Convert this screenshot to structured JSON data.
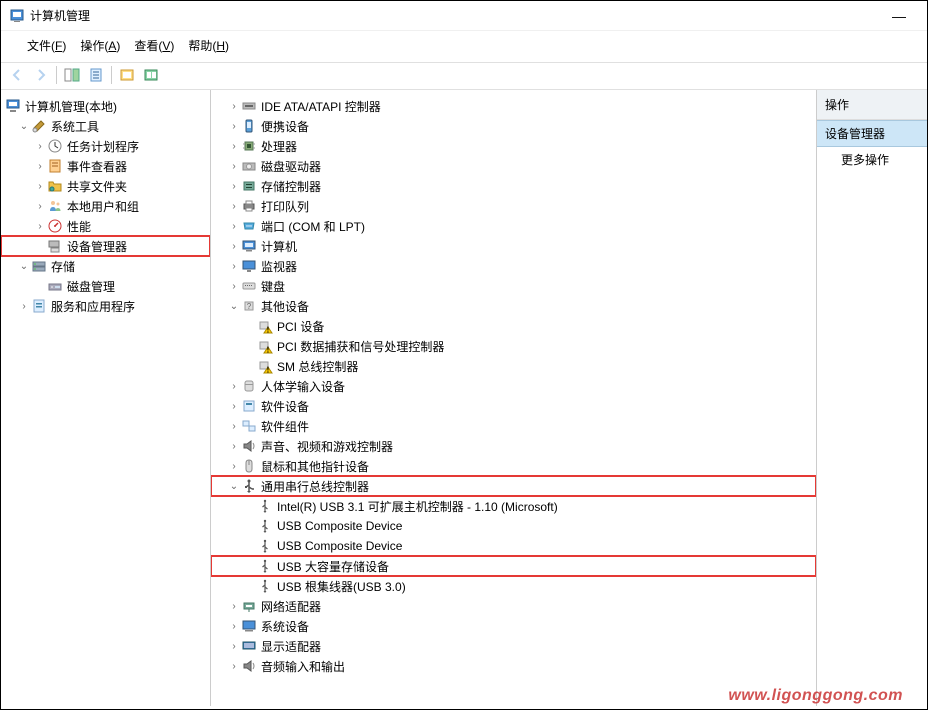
{
  "window": {
    "title": "计算机管理",
    "minimize": "—"
  },
  "menubar": {
    "file": "文件(F)",
    "action": "操作(A)",
    "view": "查看(V)",
    "help": "帮助(H)"
  },
  "left_tree": {
    "root": "计算机管理(本地)",
    "system_tools": "系统工具",
    "task_scheduler": "任务计划程序",
    "event_viewer": "事件查看器",
    "shared_folders": "共享文件夹",
    "local_users": "本地用户和组",
    "performance": "性能",
    "device_manager": "设备管理器",
    "storage": "存储",
    "disk_management": "磁盘管理",
    "services_apps": "服务和应用程序"
  },
  "dev_tree": {
    "ide": "IDE ATA/ATAPI 控制器",
    "portable": "便携设备",
    "cpu": "处理器",
    "dvd": "磁盘驱动器",
    "storage_ctrl": "存储控制器",
    "print_queue": "打印队列",
    "ports": "端口 (COM 和 LPT)",
    "computer": "计算机",
    "monitor": "监视器",
    "keyboard": "键盘",
    "other": "其他设备",
    "pci_device": "PCI 设备",
    "pci_data": "PCI 数据捕获和信号处理控制器",
    "sm_bus": "SM 总线控制器",
    "hid": "人体学输入设备",
    "software_dev": "软件设备",
    "software_comp": "软件组件",
    "sound": "声音、视频和游戏控制器",
    "mouse": "鼠标和其他指针设备",
    "usb_ctrl": "通用串行总线控制器",
    "usb_intel": "Intel(R) USB 3.1 可扩展主机控制器 - 1.10 (Microsoft)",
    "usb_comp1": "USB Composite Device",
    "usb_comp2": "USB Composite Device",
    "usb_mass": "USB 大容量存储设备",
    "usb_root": "USB 根集线器(USB 3.0)",
    "network": "网络适配器",
    "system_dev": "系统设备",
    "display": "显示适配器",
    "audio_io": "音频输入和输出"
  },
  "actions": {
    "header": "操作",
    "selected": "设备管理器",
    "more": "更多操作"
  },
  "watermark": "www.ligonggong.com"
}
